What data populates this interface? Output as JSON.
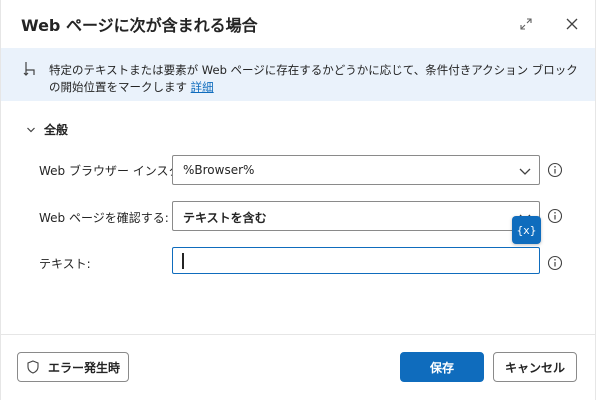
{
  "dialog": {
    "title": "Web ページに次が含まれる場合"
  },
  "infobar": {
    "text": "特定のテキストまたは要素が Web ページに存在するかどうかに応じて、条件付きアクション ブロックの開始位置をマークします",
    "link": "詳細"
  },
  "section": {
    "title": "全般"
  },
  "fields": {
    "browser_label": "Web ブラウザー インスタンス:",
    "browser_value": "%Browser%",
    "check_label": "Web ページを確認する:",
    "check_value": "テキストを含む",
    "text_label": "テキスト:",
    "text_value": ""
  },
  "var_button": {
    "label": "{x}"
  },
  "footer": {
    "error_label": "エラー発生時",
    "save_label": "保存",
    "cancel_label": "キャンセル"
  },
  "colors": {
    "accent": "#0f6cbd",
    "info_bg": "#eaf2fb"
  },
  "icons": {
    "expand": "expand-icon",
    "close": "close-icon",
    "info_bar": "flow-branch-icon",
    "section": "chevron-down-icon",
    "dropdown": "chevron-down-icon",
    "help": "info-circle-icon",
    "error": "shield-icon"
  }
}
